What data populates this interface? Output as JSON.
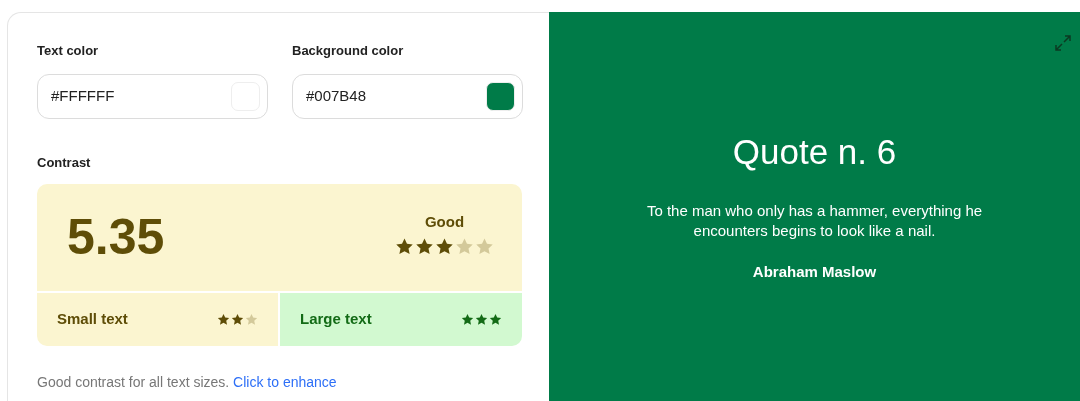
{
  "fields": [
    {
      "label": "Text color",
      "value": "#FFFFFF"
    },
    {
      "label": "Background color",
      "value": "#007B48"
    }
  ],
  "contrast": {
    "label": "Contrast",
    "ratio": "5.35",
    "rating": "Good",
    "stars": 3,
    "sizes": [
      {
        "label": "Small text",
        "stars": 2,
        "kind": "fair"
      },
      {
        "label": "Large text",
        "stars": 3,
        "kind": "pass"
      }
    ]
  },
  "summary": "Good contrast for all text sizes.",
  "enhance_link": "Click to enhance",
  "preview": {
    "title": "Quote n. 6",
    "quote": "To the man who only has a hammer, everything he encounters begins to look like a nail.",
    "author": "Abraham Maslow"
  }
}
